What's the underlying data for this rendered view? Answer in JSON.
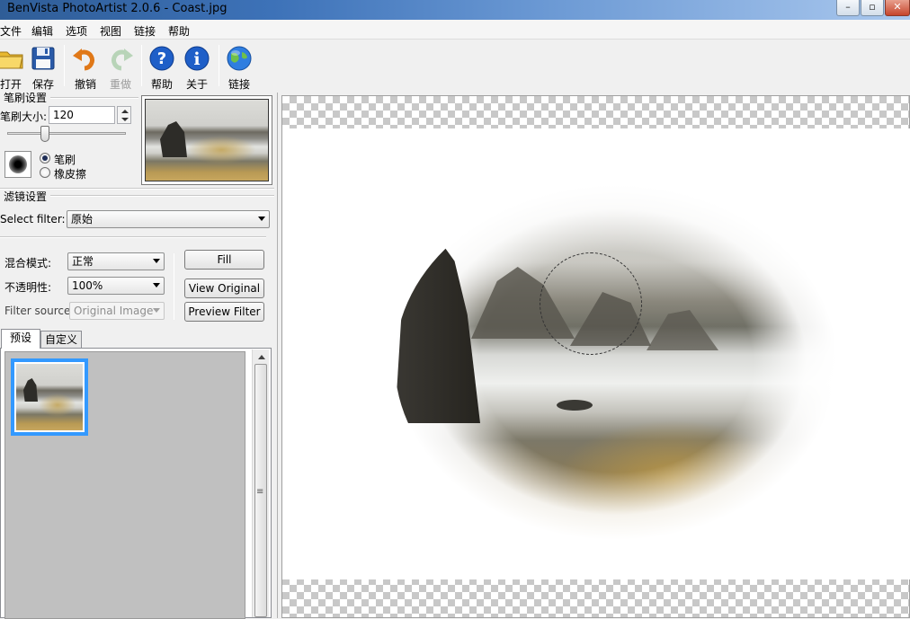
{
  "window": {
    "title": "BenVista PhotoArtist 2.0.6 - Coast.jpg",
    "minimize_glyph": "–",
    "maximize_glyph": "▫",
    "close_glyph": "✕"
  },
  "menu": [
    "文件",
    "编辑",
    "选项",
    "视图",
    "链接",
    "帮助"
  ],
  "toolbar": {
    "open": "打开",
    "save": "保存",
    "undo": "撤销",
    "redo": "重做",
    "help": "帮助",
    "about": "关于",
    "link": "链接"
  },
  "brush": {
    "section": "笔刷设置",
    "size_label": "笔刷大小:",
    "size_value": "120",
    "slider_fraction": 0.3,
    "mode_brush": "笔刷",
    "mode_eraser": "橡皮擦"
  },
  "filter": {
    "section": "滤镜设置",
    "select_label": "Select filter:",
    "select_value": "原始",
    "blend_label": "混合模式:",
    "blend_value": "正常",
    "opacity_label": "不透明性:",
    "opacity_value": "100%",
    "source_label": "Filter source:",
    "source_value": "Original Image",
    "fill_button": "Fill",
    "view_original_button": "View Original",
    "preview_filter_button": "Preview Filter"
  },
  "tabs": {
    "preset": "预设",
    "custom": "自定义"
  },
  "scrollbar": {
    "grip_glyph": "≡"
  },
  "colors": {
    "accent": "#3399ff",
    "titlebar": "#3d72b8",
    "panel_gray": "#c0c0c0"
  },
  "icons": {
    "open": "folder-icon",
    "save": "floppy-icon",
    "undo": "undo-arrow-icon",
    "redo": "redo-arrow-icon",
    "help": "question-icon",
    "about": "info-icon",
    "link": "globe-icon"
  }
}
